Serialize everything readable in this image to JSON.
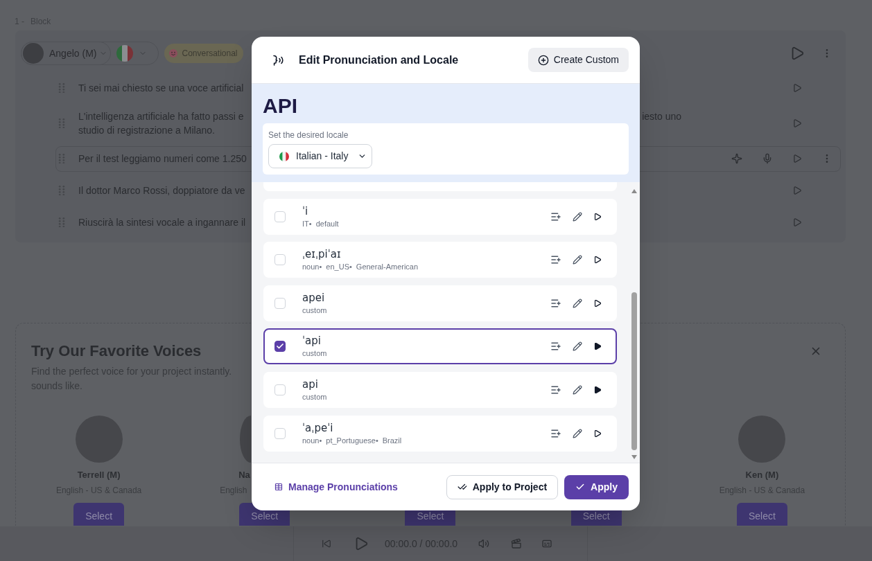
{
  "block": {
    "number": "1 -",
    "title": "Block",
    "voice": "Angelo (M)",
    "style": "Conversational",
    "sentences": [
      {
        "text": "Ti sei mai chiesto se una voce artificial",
        "selected": false
      },
      {
        "text": "L'intelligenza artificiale ha fatto passi e",
        "tail": "iesto uno",
        "second_line": "studio di registrazione a Milano.",
        "selected": false
      },
      {
        "text": "Per il test leggiamo numeri come 1.250",
        "selected": true
      },
      {
        "text": "Il dottor Marco Rossi, doppiatore da ve",
        "selected": false
      },
      {
        "text": "Riuscirà la sintesi vocale a ingannare il",
        "selected": false
      }
    ]
  },
  "dialog": {
    "title": "Edit Pronunciation and Locale",
    "create_button": "Create Custom",
    "word": "API",
    "locale_label": "Set the desired locale",
    "locale": "Italian - Italy",
    "pronunciations": [
      {
        "phonetic": "ˈi",
        "tags": [
          "IT•",
          "default"
        ],
        "checked": false,
        "play_filled": false
      },
      {
        "phonetic": "ˌeɪˌpiˈaɪ",
        "tags": [
          "noun•",
          "en_US•",
          "General-American"
        ],
        "checked": false,
        "play_filled": false
      },
      {
        "phonetic": "apei",
        "tags": [
          "custom"
        ],
        "checked": false,
        "play_filled": false
      },
      {
        "phonetic": "ˈapi",
        "tags": [
          "custom"
        ],
        "checked": true,
        "play_filled": true
      },
      {
        "phonetic": "api",
        "tags": [
          "custom"
        ],
        "checked": false,
        "play_filled": true
      },
      {
        "phonetic": "ˈaˌpeˈi",
        "tags": [
          "noun•",
          "pt_Portuguese•",
          "Brazil"
        ],
        "checked": false,
        "play_filled": false
      }
    ],
    "manage_link": "Manage Pronunciations",
    "apply_project_button": "Apply to Project",
    "apply_button": "Apply"
  },
  "favorites": {
    "title": "Try Our Favorite Voices",
    "description_lines": [
      "Find the perfect voice for your project instantly.",
      "sounds like."
    ],
    "voices": [
      {
        "kind": "full",
        "name": "Terrell (M)",
        "language": "English - US & Canada",
        "button": "Select"
      },
      {
        "kind": "partial",
        "name": "Na",
        "language": "English",
        "button": "Select"
      },
      {
        "kind": "hidden",
        "button": "Select"
      },
      {
        "kind": "hidden",
        "button": "Select"
      },
      {
        "kind": "full",
        "name": "Ken (M)",
        "language": "English - US & Canada",
        "button": "Select"
      }
    ]
  },
  "player": {
    "time": "00:00.0 / 00:00.0"
  }
}
